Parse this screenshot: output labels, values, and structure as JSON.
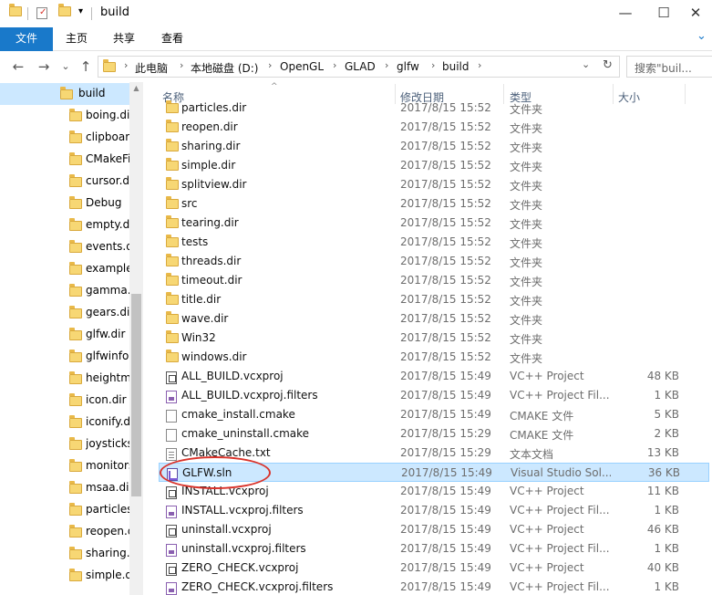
{
  "window": {
    "title": "build",
    "controls": {
      "minimize": "—",
      "maximize": "☐",
      "close": "✕"
    },
    "qa_dropdown": "▾"
  },
  "ribbon": {
    "tabs": [
      "文件",
      "主页",
      "共享",
      "查看"
    ],
    "expand": "⌄"
  },
  "address": {
    "back": "←",
    "forward": "→",
    "history": "⌄",
    "up": "↑",
    "crumbs": [
      "此电脑",
      "本地磁盘 (D:)",
      "OpenGL",
      "GLAD",
      "glfw",
      "build"
    ],
    "sep": "›",
    "dropdown": "⌄",
    "refresh": "↻",
    "search_placeholder": "搜索\"buil..."
  },
  "nav": {
    "items": [
      {
        "label": "build",
        "selected": true
      },
      {
        "label": "boing.dir"
      },
      {
        "label": "clipboard.dir"
      },
      {
        "label": "CMakeFiles"
      },
      {
        "label": "cursor.dir"
      },
      {
        "label": "Debug"
      },
      {
        "label": "empty.dir"
      },
      {
        "label": "events.dir"
      },
      {
        "label": "examples"
      },
      {
        "label": "gamma.dir"
      },
      {
        "label": "gears.dir"
      },
      {
        "label": "glfw.dir"
      },
      {
        "label": "glfwinfo.dir"
      },
      {
        "label": "heightmap.dir"
      },
      {
        "label": "icon.dir"
      },
      {
        "label": "iconify.dir"
      },
      {
        "label": "joysticks.dir"
      },
      {
        "label": "monitors.dir"
      },
      {
        "label": "msaa.dir"
      },
      {
        "label": "particles.dir"
      },
      {
        "label": "reopen.dir"
      },
      {
        "label": "sharing.dir"
      },
      {
        "label": "simple.dir"
      }
    ],
    "scroll_up": "▲"
  },
  "columns": {
    "name": "名称",
    "date": "修改日期",
    "type": "类型",
    "size": "大小",
    "sort_indicator": "^"
  },
  "files": [
    {
      "name": "particles.dir",
      "date": "2017/8/15 15:52",
      "type": "文件夹",
      "size": "",
      "icon": "folder"
    },
    {
      "name": "reopen.dir",
      "date": "2017/8/15 15:52",
      "type": "文件夹",
      "size": "",
      "icon": "folder"
    },
    {
      "name": "sharing.dir",
      "date": "2017/8/15 15:52",
      "type": "文件夹",
      "size": "",
      "icon": "folder"
    },
    {
      "name": "simple.dir",
      "date": "2017/8/15 15:52",
      "type": "文件夹",
      "size": "",
      "icon": "folder"
    },
    {
      "name": "splitview.dir",
      "date": "2017/8/15 15:52",
      "type": "文件夹",
      "size": "",
      "icon": "folder"
    },
    {
      "name": "src",
      "date": "2017/8/15 15:52",
      "type": "文件夹",
      "size": "",
      "icon": "folder"
    },
    {
      "name": "tearing.dir",
      "date": "2017/8/15 15:52",
      "type": "文件夹",
      "size": "",
      "icon": "folder"
    },
    {
      "name": "tests",
      "date": "2017/8/15 15:52",
      "type": "文件夹",
      "size": "",
      "icon": "folder"
    },
    {
      "name": "threads.dir",
      "date": "2017/8/15 15:52",
      "type": "文件夹",
      "size": "",
      "icon": "folder"
    },
    {
      "name": "timeout.dir",
      "date": "2017/8/15 15:52",
      "type": "文件夹",
      "size": "",
      "icon": "folder"
    },
    {
      "name": "title.dir",
      "date": "2017/8/15 15:52",
      "type": "文件夹",
      "size": "",
      "icon": "folder"
    },
    {
      "name": "wave.dir",
      "date": "2017/8/15 15:52",
      "type": "文件夹",
      "size": "",
      "icon": "folder"
    },
    {
      "name": "Win32",
      "date": "2017/8/15 15:52",
      "type": "文件夹",
      "size": "",
      "icon": "folder"
    },
    {
      "name": "windows.dir",
      "date": "2017/8/15 15:52",
      "type": "文件夹",
      "size": "",
      "icon": "folder"
    },
    {
      "name": "ALL_BUILD.vcxproj",
      "date": "2017/8/15 15:49",
      "type": "VC++ Project",
      "size": "48 KB",
      "icon": "proj"
    },
    {
      "name": "ALL_BUILD.vcxproj.filters",
      "date": "2017/8/15 15:49",
      "type": "VC++ Project Fil...",
      "size": "1 KB",
      "icon": "filters"
    },
    {
      "name": "cmake_install.cmake",
      "date": "2017/8/15 15:49",
      "type": "CMAKE 文件",
      "size": "5 KB",
      "icon": "file"
    },
    {
      "name": "cmake_uninstall.cmake",
      "date": "2017/8/15 15:29",
      "type": "CMAKE 文件",
      "size": "2 KB",
      "icon": "file"
    },
    {
      "name": "CMakeCache.txt",
      "date": "2017/8/15 15:29",
      "type": "文本文档",
      "size": "13 KB",
      "icon": "txt"
    },
    {
      "name": "GLFW.sln",
      "date": "2017/8/15 15:49",
      "type": "Visual Studio Sol...",
      "size": "36 KB",
      "icon": "sln",
      "selected": true
    },
    {
      "name": "INSTALL.vcxproj",
      "date": "2017/8/15 15:49",
      "type": "VC++ Project",
      "size": "11 KB",
      "icon": "proj"
    },
    {
      "name": "INSTALL.vcxproj.filters",
      "date": "2017/8/15 15:49",
      "type": "VC++ Project Fil...",
      "size": "1 KB",
      "icon": "filters"
    },
    {
      "name": "uninstall.vcxproj",
      "date": "2017/8/15 15:49",
      "type": "VC++ Project",
      "size": "46 KB",
      "icon": "proj"
    },
    {
      "name": "uninstall.vcxproj.filters",
      "date": "2017/8/15 15:49",
      "type": "VC++ Project Fil...",
      "size": "1 KB",
      "icon": "filters"
    },
    {
      "name": "ZERO_CHECK.vcxproj",
      "date": "2017/8/15 15:49",
      "type": "VC++ Project",
      "size": "40 KB",
      "icon": "proj"
    },
    {
      "name": "ZERO_CHECK.vcxproj.filters",
      "date": "2017/8/15 15:49",
      "type": "VC++ Project Fil...",
      "size": "1 KB",
      "icon": "filters"
    }
  ],
  "colors": {
    "accent": "#1979ca",
    "selection": "#cce8ff",
    "annotation": "#d9332b"
  }
}
